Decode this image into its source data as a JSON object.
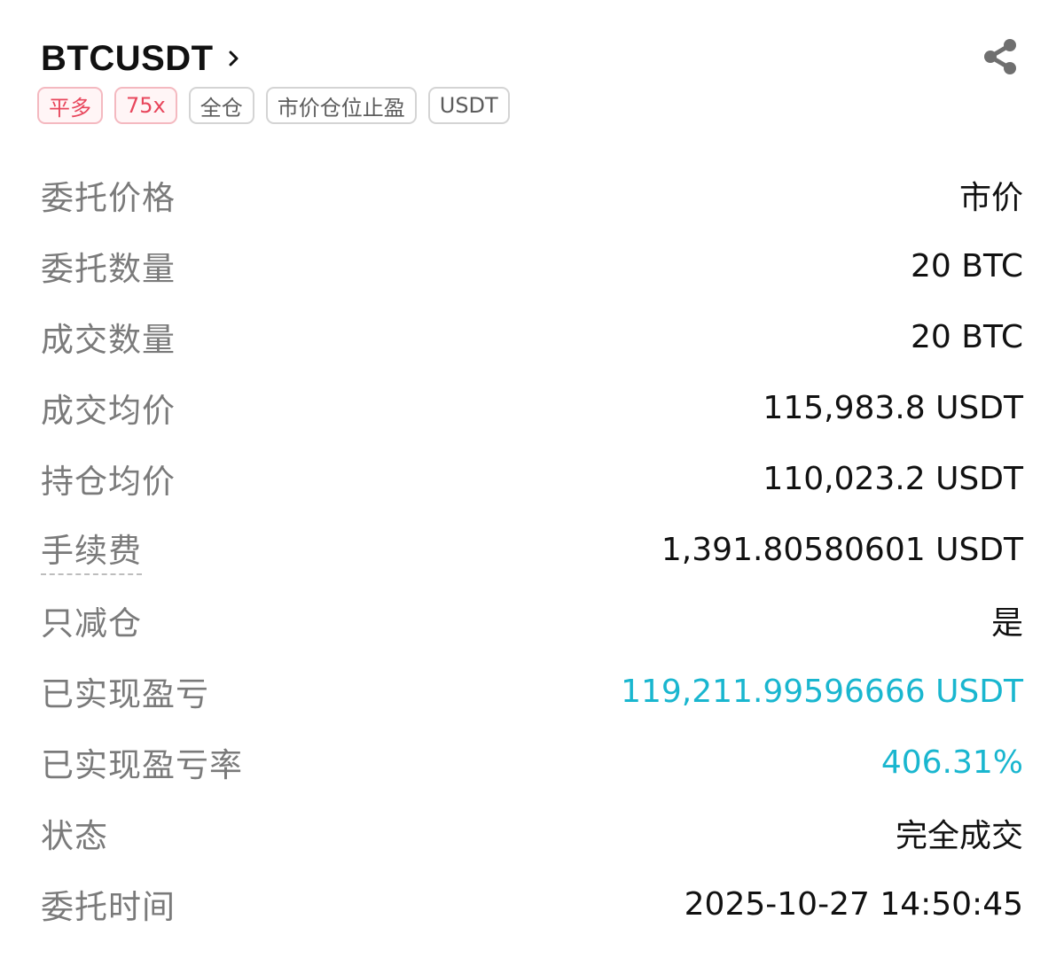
{
  "header": {
    "symbol": "BTCUSDT",
    "chevron_icon": "chevron-right-icon",
    "share_icon": "share-icon"
  },
  "tags": [
    {
      "label": "平多",
      "style": "red"
    },
    {
      "label": "75x",
      "style": "red"
    },
    {
      "label": "全仓",
      "style": "gray"
    },
    {
      "label": "市价仓位止盈",
      "style": "gray"
    },
    {
      "label": "USDT",
      "style": "gray"
    }
  ],
  "details": [
    {
      "label": "委托价格",
      "value": "市价"
    },
    {
      "label": "委托数量",
      "value": "20 BTC"
    },
    {
      "label": "成交数量",
      "value": "20 BTC"
    },
    {
      "label": "成交均价",
      "value": "115,983.8 USDT"
    },
    {
      "label": "持仓均价",
      "value": "110,023.2 USDT"
    },
    {
      "label": "手续费",
      "value": "1,391.80580601 USDT"
    },
    {
      "label": "只减仓",
      "value": "是"
    },
    {
      "label": "已实现盈亏",
      "value": "119,211.99596666 USDT"
    },
    {
      "label": "已实现盈亏率",
      "value": "406.31%"
    },
    {
      "label": "状态",
      "value": "完全成交"
    },
    {
      "label": "委托时间",
      "value": "2025-10-27 14:50:45"
    }
  ],
  "colors": {
    "profit": "#19b6cf",
    "tag_red": "#e8465c",
    "label_gray": "#7a7a7a"
  }
}
